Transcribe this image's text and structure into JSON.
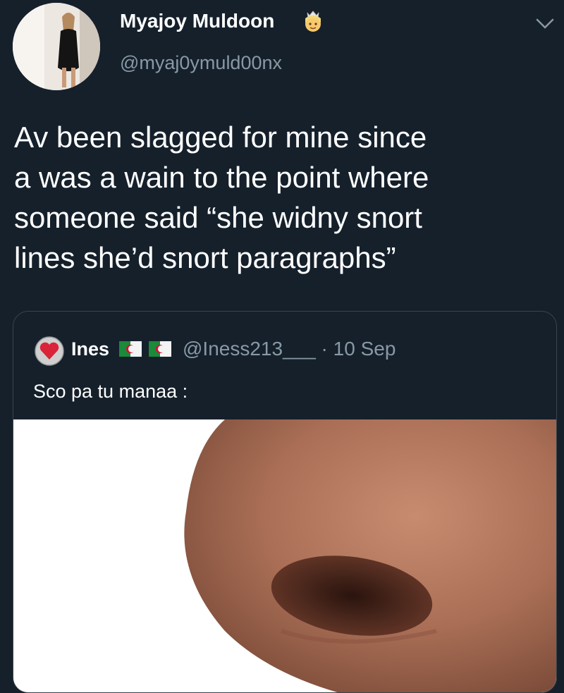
{
  "author": {
    "display_name": "Myajoy Muldoon",
    "handle": "@myaj0ymuld00nx",
    "name_emoji": "princess-emoji"
  },
  "tweet": {
    "text_lines": [
      "Av been slagged for mine since",
      "a was a wain to the point where",
      "someone said “she widny snort",
      "lines she’d snort paragraphs”"
    ]
  },
  "quoted_tweet": {
    "name": "Ines",
    "handle_and_date": "@Iness213___ · 10 Sep",
    "flags": [
      "algeria-flag-icon",
      "algeria-flag-icon"
    ],
    "text": "Sco pa tu manaa :",
    "media": "nose-closeup-photo"
  },
  "colors": {
    "background": "#15202b",
    "secondary_text": "#8899a6",
    "border": "#38444d"
  }
}
